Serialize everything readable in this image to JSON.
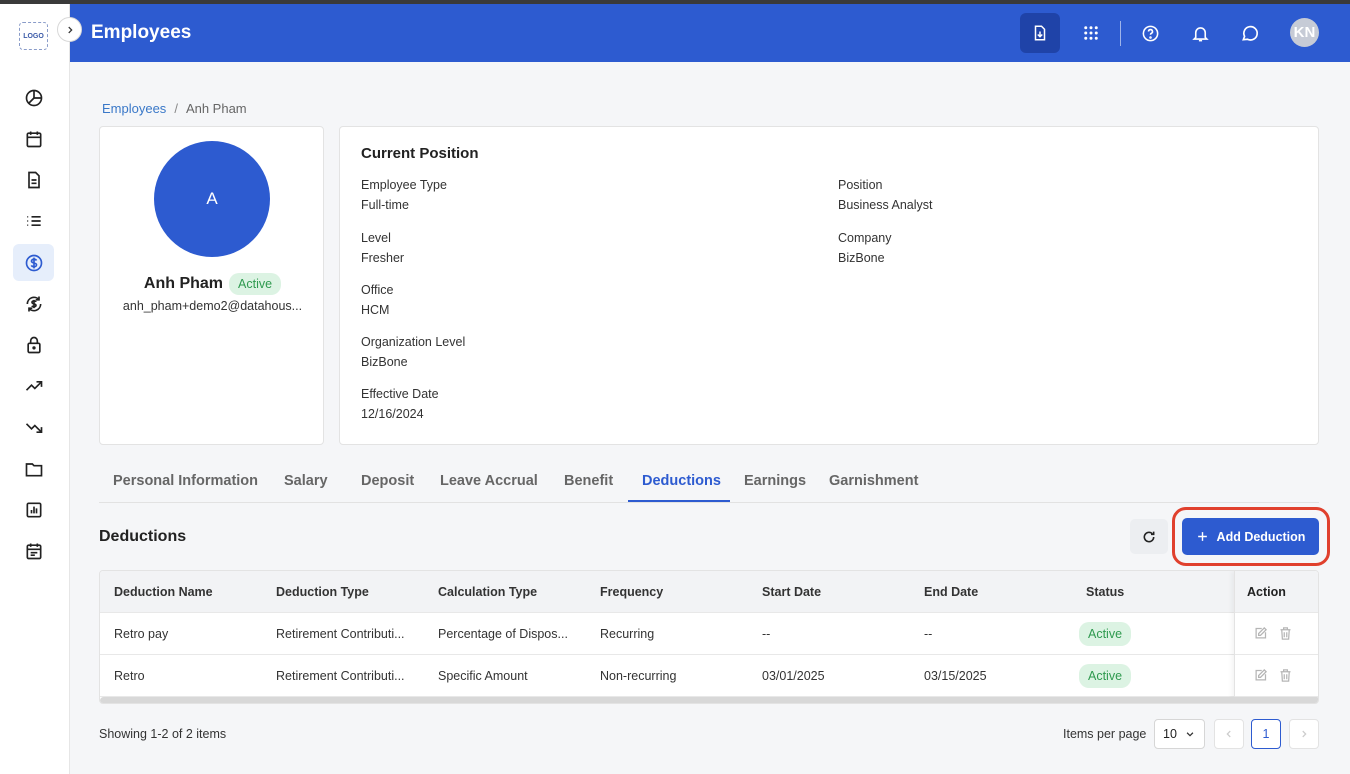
{
  "app": {
    "logo_text": "LOGO",
    "page_title": "Employees",
    "avatar_initials": "KN"
  },
  "colors": {
    "primary": "#2d5bd0",
    "success_bg": "#dcf3e3",
    "success_text": "#2f9a4f",
    "highlight": "#e0402d"
  },
  "sidebar": {
    "items": [
      {
        "icon": "pie-chart-icon"
      },
      {
        "icon": "calendar-icon"
      },
      {
        "icon": "document-icon"
      },
      {
        "icon": "list-icon"
      },
      {
        "icon": "dollar-icon",
        "active": true
      },
      {
        "icon": "exchange-dollar-icon"
      },
      {
        "icon": "lock-icon"
      },
      {
        "icon": "trending-up-icon"
      },
      {
        "icon": "trending-down-icon"
      },
      {
        "icon": "folder-icon"
      },
      {
        "icon": "bar-chart-icon"
      },
      {
        "icon": "schedule-icon"
      }
    ]
  },
  "header": {
    "icons": [
      "download-icon",
      "apps-grid-icon",
      "help-icon",
      "bell-icon",
      "chat-icon"
    ]
  },
  "breadcrumb": {
    "parent": "Employees",
    "separator": "/",
    "current": "Anh Pham"
  },
  "profile": {
    "initial": "A",
    "name": "Anh Pham",
    "status": "Active",
    "email": "anh_pham+demo2@datahous..."
  },
  "position": {
    "title": "Current Position",
    "fields": {
      "employee_type": {
        "label": "Employee Type",
        "value": "Full-time"
      },
      "position": {
        "label": "Position",
        "value": "Business Analyst"
      },
      "level": {
        "label": "Level",
        "value": "Fresher"
      },
      "company": {
        "label": "Company",
        "value": "BizBone"
      },
      "office": {
        "label": "Office",
        "value": "HCM"
      },
      "org_level": {
        "label": "Organization Level",
        "value": "BizBone"
      },
      "effective_date": {
        "label": "Effective Date",
        "value": "12/16/2024"
      }
    }
  },
  "tabs": [
    "Personal Information",
    "Salary",
    "Deposit",
    "Leave Accrual",
    "Benefit",
    "Deductions",
    "Earnings",
    "Garnishment"
  ],
  "active_tab": "Deductions",
  "deductions": {
    "title": "Deductions",
    "add_label": "Add Deduction",
    "columns": [
      "Deduction Name",
      "Deduction Type",
      "Calculation Type",
      "Frequency",
      "Start Date",
      "End Date",
      "Status",
      "Action"
    ],
    "rows": [
      [
        "Retro pay",
        "Retirement Contributi...",
        "Percentage of Dispos...",
        "Recurring",
        "--",
        "--",
        "Active"
      ],
      [
        "Retro",
        "Retirement Contributi...",
        "Specific Amount",
        "Non-recurring",
        "03/01/2025",
        "03/15/2025",
        "Active"
      ]
    ]
  },
  "pagination": {
    "showing": "Showing 1-2 of 2 items",
    "items_per_page_label": "Items per page",
    "items_per_page": "10",
    "current_page": "1"
  }
}
